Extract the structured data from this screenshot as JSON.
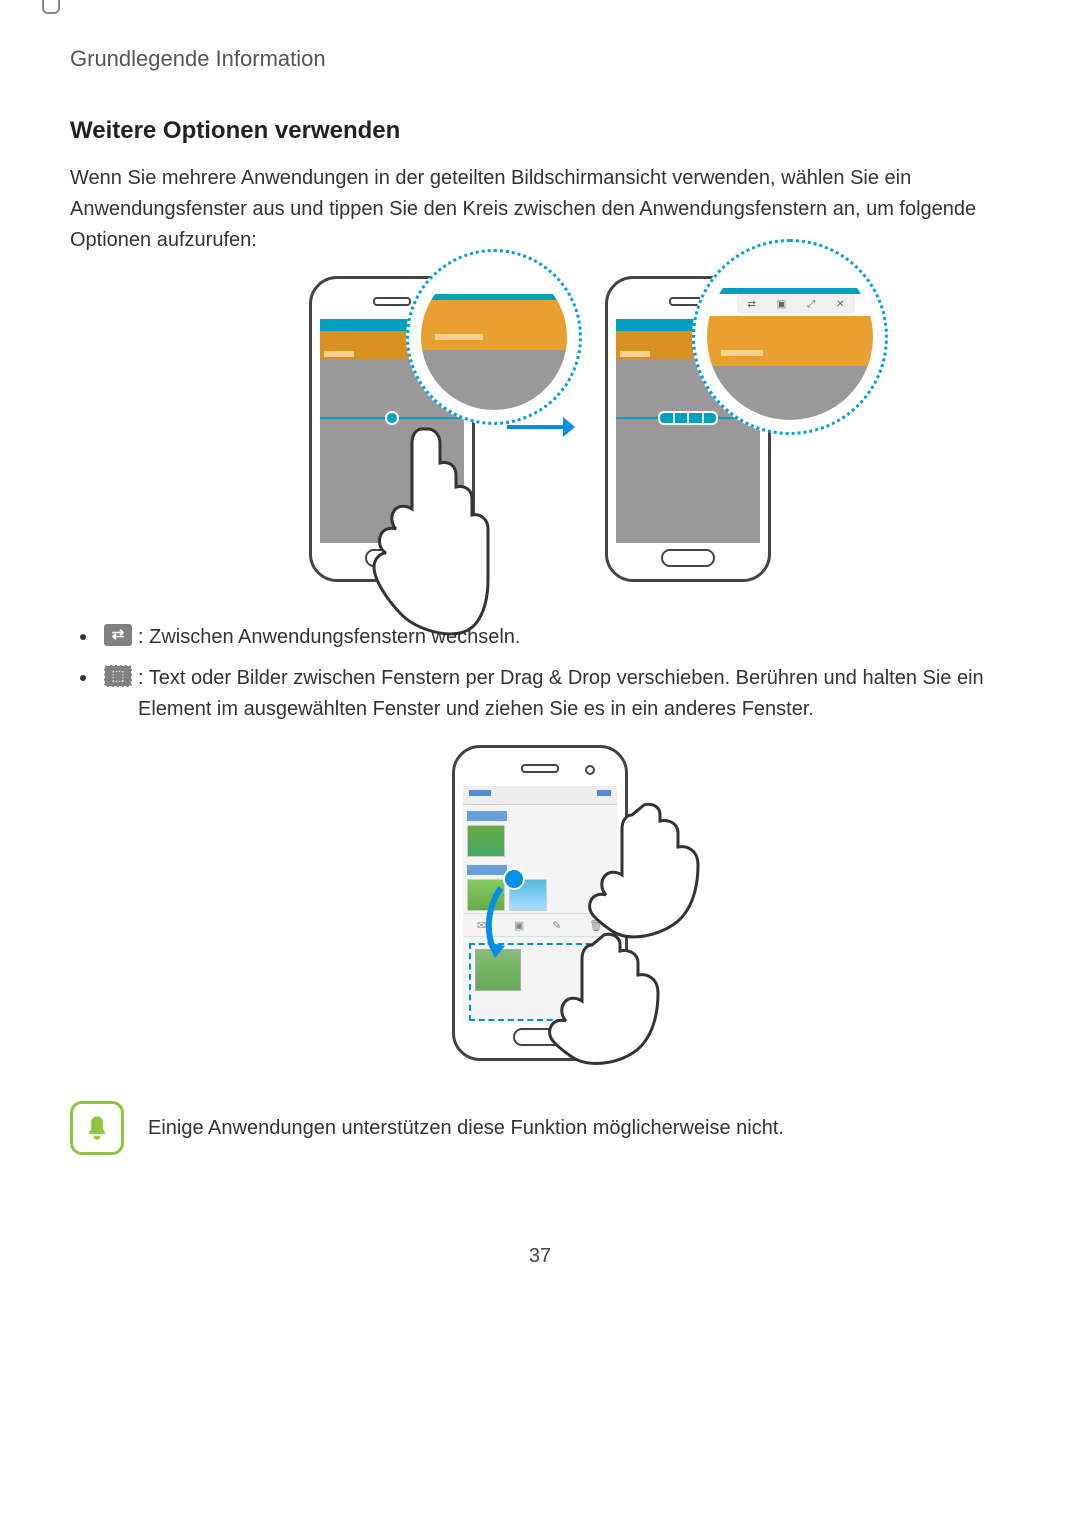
{
  "breadcrumb": "Grundlegende Information",
  "heading": "Weitere Optionen verwenden",
  "intro": "Wenn Sie mehrere Anwendungen in der geteilten Bildschirmansicht verwenden, wählen Sie ein Anwendungsfenster aus und tippen Sie den Kreis zwischen den Anwendungsfenstern an, um folgende Optionen aufzurufen:",
  "bullets": {
    "swap": ": Zwischen Anwendungsfenstern wechseln.",
    "drag": ": Text oder Bilder zwischen Fenstern per Drag & Drop verschieben. Berühren und halten Sie ein Element im ausgewählten Fenster und ziehen Sie es in ein anderes Fenster."
  },
  "note": "Einige Anwendungen unterstützen diese Funktion möglicherweise nicht.",
  "callout2_icons": [
    "⇄",
    "▣",
    "⤢",
    "✕"
  ],
  "iconbar_glyphs": [
    "✉",
    "▣",
    "✎",
    "🗑"
  ],
  "page_number": "37"
}
